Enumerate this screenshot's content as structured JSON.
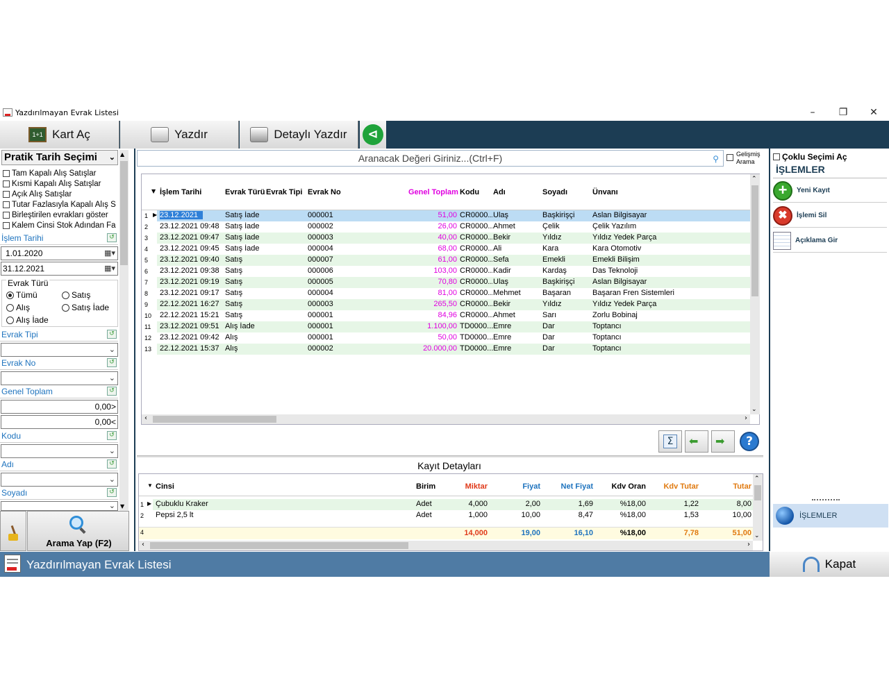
{
  "window": {
    "title": "Yazdırılmayan Evrak Listesi"
  },
  "toolbar": {
    "kart_ac": "Kart Aç",
    "yazdir": "Yazdır",
    "detayli_yazdir": "Detaylı Yazdır",
    "kart_ac_icon": "1+1"
  },
  "left": {
    "title": "Pratik Tarih Seçimi",
    "checks": [
      "Tam Kapalı Alış Satışlar",
      "Kısmi Kapalı Alış Satışlar",
      "Açık Alış Satışlar",
      "Tutar Fazlasıyla Kapalı Alış S",
      "Birleştirilen evrakları göster",
      "Kalem Cinsi Stok Adından Fa"
    ],
    "islem_tarihi_label": "İşlem Tarihi",
    "date_from": "1.01.2020",
    "date_to": "31.12.2021",
    "evrak_turu_label": "Evrak Türü",
    "radios": {
      "tumu": "Tümü",
      "satis": "Satış",
      "alis": "Alış",
      "satis_iade": "Satış İade",
      "alis_iade": "Alış İade"
    },
    "evrak_tipi_label": "Evrak Tipi",
    "evrak_no_label": "Evrak No",
    "genel_toplam_label": "Genel Toplam",
    "gt_min": "0,00>",
    "gt_max": "0,00<",
    "kodu_label": "Kodu",
    "adi_label": "Adı",
    "soyadi_label": "Soyadı",
    "search_button": "Arama Yap (F2)"
  },
  "search": {
    "placeholder": "Aranacak Değeri Giriniz...(Ctrl+F)",
    "gelismis": "Gelişmiş",
    "arama": "Arama"
  },
  "grid": {
    "headers": [
      "İşlem Tarihi",
      "Evrak Türü",
      "Evrak Tipi",
      "Evrak No",
      "Genel Toplam",
      "Kodu",
      "Adı",
      "Soyadı",
      "Ünvanı"
    ],
    "rows": [
      [
        "1",
        "23.12.2021",
        "Satış İade",
        "",
        "000001",
        "51,00",
        "CR0000...",
        "Ulaş",
        "Başkirişçi",
        "Aslan Bilgisayar"
      ],
      [
        "2",
        "23.12.2021 09:48",
        "Satış İade",
        "",
        "000002",
        "26,00",
        "CR0000...",
        "Ahmet",
        "Çelik",
        "Çelik Yazılım"
      ],
      [
        "3",
        "23.12.2021 09:47",
        "Satış İade",
        "",
        "000003",
        "40,00",
        "CR0000...",
        "Bekir",
        "Yıldız",
        "Yıldız Yedek Parça"
      ],
      [
        "4",
        "23.12.2021 09:45",
        "Satış İade",
        "",
        "000004",
        "68,00",
        "CR0000...",
        "Ali",
        "Kara",
        "Kara Otomotiv"
      ],
      [
        "5",
        "23.12.2021 09:40",
        "Satış",
        "",
        "000007",
        "61,00",
        "CR0000...",
        "Sefa",
        "Emekli",
        "Emekli Bilişim"
      ],
      [
        "6",
        "23.12.2021 09:38",
        "Satış",
        "",
        "000006",
        "103,00",
        "CR0000...",
        "Kadir",
        "Kardaş",
        "Das Teknoloji"
      ],
      [
        "7",
        "23.12.2021 09:19",
        "Satış",
        "",
        "000005",
        "70,80",
        "CR0000...",
        "Ulaş",
        "Başkirişçi",
        "Aslan Bilgisayar"
      ],
      [
        "8",
        "23.12.2021 09:17",
        "Satış",
        "",
        "000004",
        "81,00",
        "CR0000...",
        "Mehmet",
        "Başaran",
        "Başaran Fren Sistemleri"
      ],
      [
        "9",
        "22.12.2021 16:27",
        "Satış",
        "",
        "000003",
        "265,50",
        "CR0000...",
        "Bekir",
        "Yıldız",
        "Yıldız Yedek Parça"
      ],
      [
        "10",
        "22.12.2021 15:21",
        "Satış",
        "",
        "000001",
        "84,96",
        "CR0000...",
        "Ahmet",
        "Sarı",
        "Zorlu Bobinaj"
      ],
      [
        "11",
        "23.12.2021 09:51",
        "Alış İade",
        "",
        "000001",
        "1.100,00",
        "TD0000...",
        "Emre",
        "Dar",
        "Toptancı"
      ],
      [
        "12",
        "23.12.2021 09:42",
        "Alış",
        "",
        "000001",
        "50,00",
        "TD0000...",
        "Emre",
        "Dar",
        "Toptancı"
      ],
      [
        "13",
        "22.12.2021 15:37",
        "Alış",
        "",
        "000002",
        "20.000,00",
        "TD0000...",
        "Emre",
        "Dar",
        "Toptancı"
      ]
    ]
  },
  "detail": {
    "title": "Kayıt Detayları",
    "headers": [
      "Cinsi",
      "Birim",
      "Miktar",
      "Fiyat",
      "Net Fiyat",
      "Kdv Oran",
      "Kdv Tutar",
      "Tutar"
    ],
    "rows": [
      [
        "1",
        "Çubuklu Kraker",
        "Adet",
        "4,000",
        "2,00",
        "1,69",
        "%18,00",
        "1,22",
        "8,00"
      ],
      [
        "2",
        "Pepsi 2,5 lt",
        "Adet",
        "1,000",
        "10,00",
        "8,47",
        "%18,00",
        "1,53",
        "10,00"
      ]
    ],
    "footer": [
      "4",
      "",
      "",
      "14,000",
      "19,00",
      "16,10",
      "%18,00",
      "7,78",
      "51,00"
    ]
  },
  "right": {
    "coklu": "Çoklu Seçimi Aç",
    "islemler": "İŞLEMLER",
    "yeni_kayit": "Yeni Kayıt",
    "islemi_sil": "İşlemi Sil",
    "aciklama_gir": "Açıklama Gir",
    "islemler_tab": "İŞLEMLER"
  },
  "status": {
    "title": "Yazdırılmayan Evrak Listesi",
    "kapat": "Kapat"
  },
  "colors": {
    "dark": "#1c3d54",
    "status": "#4f7ba4",
    "row_green": "#e6f6e6",
    "selected": "#bcdcf4",
    "magenta": "#e000e0"
  }
}
